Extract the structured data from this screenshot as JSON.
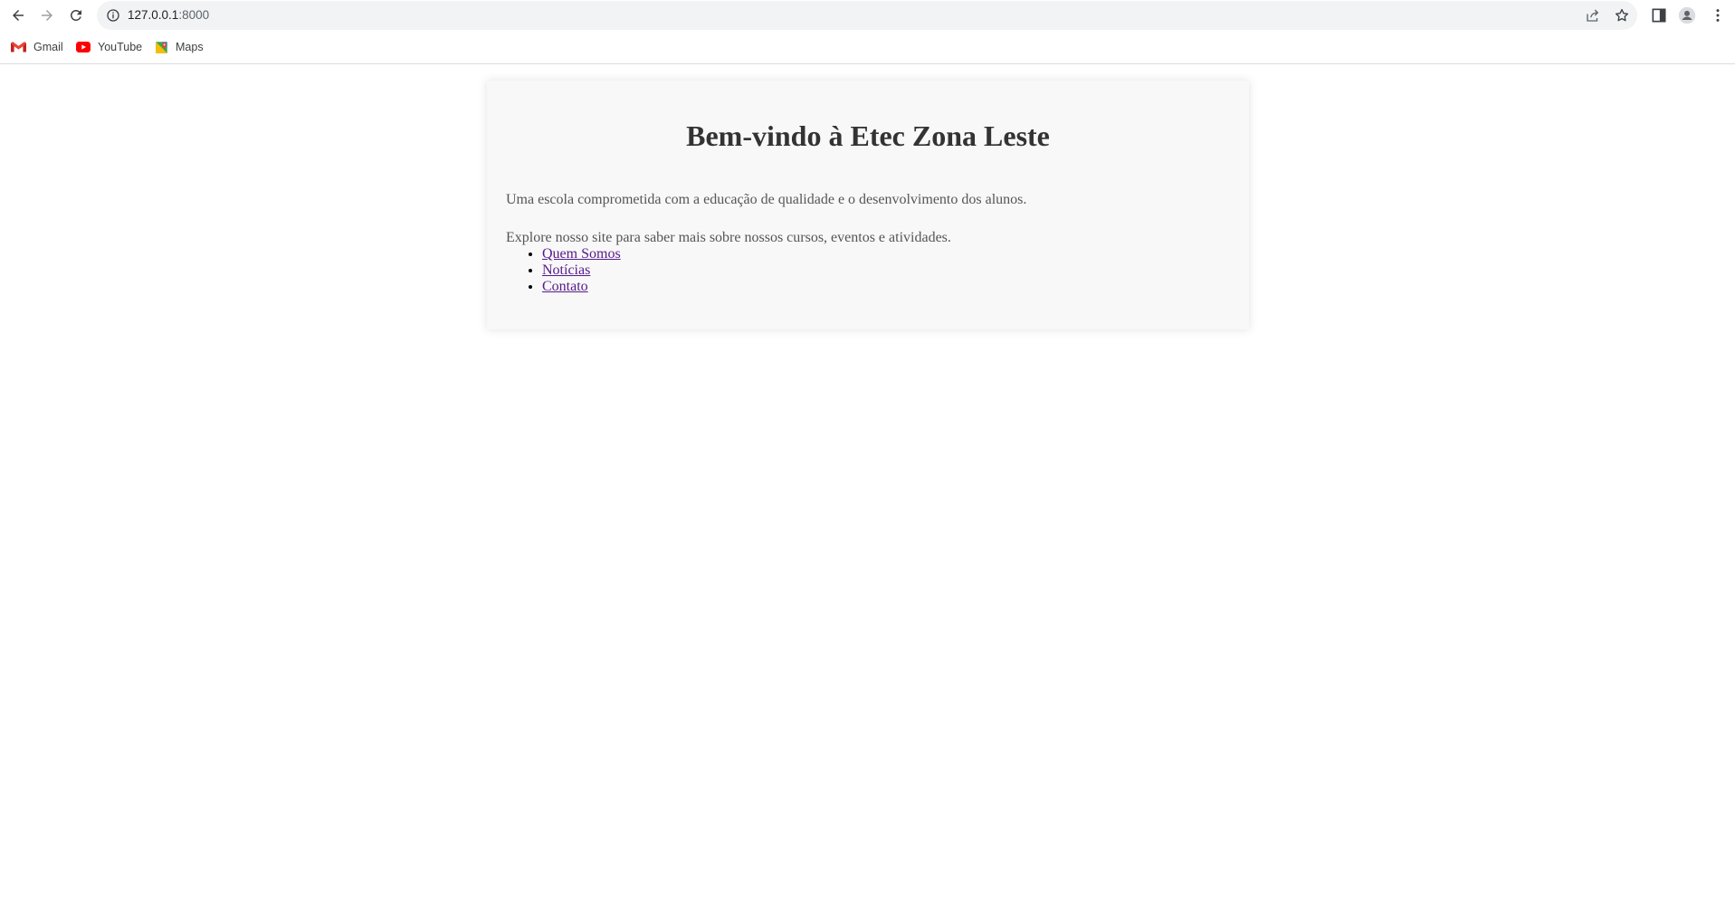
{
  "browser": {
    "url_host": "127.0.0.1",
    "url_port": ":8000",
    "bookmarks": [
      {
        "label": "Gmail",
        "icon": "gmail-icon"
      },
      {
        "label": "YouTube",
        "icon": "youtube-icon"
      },
      {
        "label": "Maps",
        "icon": "maps-icon"
      }
    ]
  },
  "page": {
    "title": "Bem-vindo à Etec Zona Leste",
    "paragraph1": "Uma escola comprometida com a educação de qualidade e o desenvolvimento dos alunos.",
    "paragraph2": "Explore nosso site para saber mais sobre nossos cursos, eventos e atividades.",
    "links": [
      {
        "label": "Quem Somos"
      },
      {
        "label": "Notícias"
      },
      {
        "label": "Contato"
      }
    ]
  },
  "colors": {
    "card_background": "#f8f8f8",
    "heading": "#333333",
    "text": "#555555",
    "link_visited": "#551a8b"
  }
}
